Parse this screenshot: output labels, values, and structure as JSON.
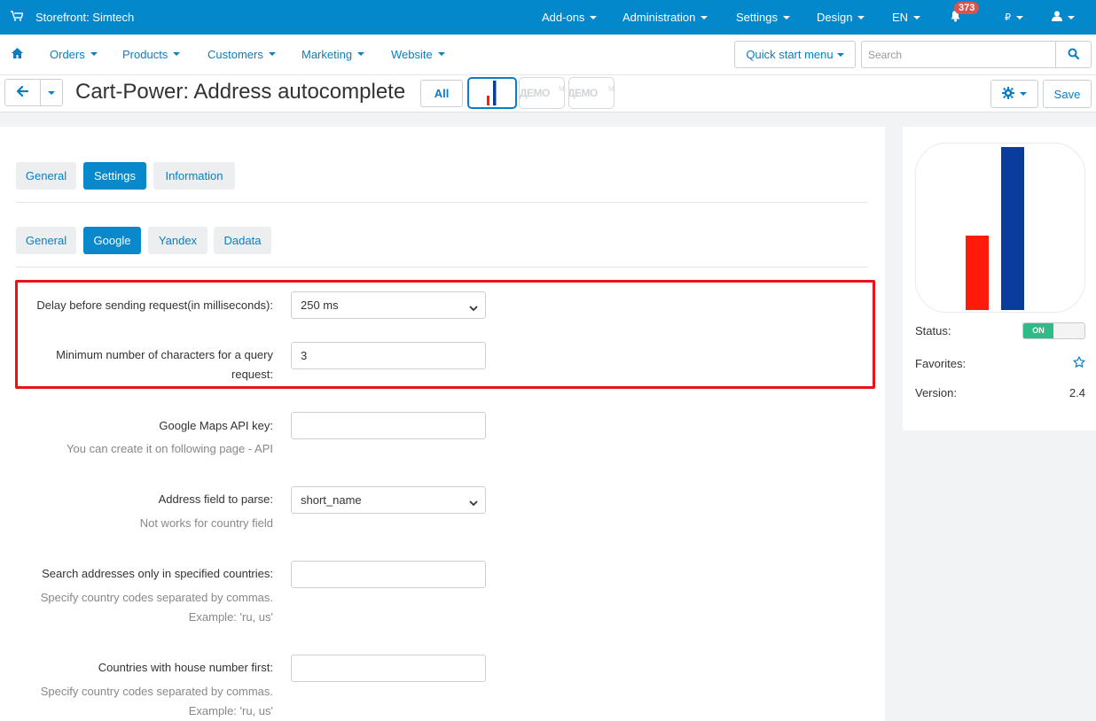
{
  "topbar": {
    "store": "Storefront: Simtech",
    "menus": [
      "Add-ons",
      "Administration",
      "Settings",
      "Design",
      "EN"
    ],
    "notifications": "373",
    "currency": "₽"
  },
  "nav": {
    "items": [
      "Orders",
      "Products",
      "Customers",
      "Marketing",
      "Website"
    ],
    "quick_start": "Quick start menu",
    "search_placeholder": "Search"
  },
  "titlebar": {
    "title": "Cart-Power: Address autocomplete",
    "all": "All",
    "demo": "ДЕМО",
    "demo_suffix": "МА",
    "save": "Save"
  },
  "tabs": {
    "main": [
      "General",
      "Settings",
      "Information"
    ],
    "sub": [
      "General",
      "Google",
      "Yandex",
      "Dadata"
    ]
  },
  "form": {
    "delay_label": "Delay before sending request(in milliseconds):",
    "delay_value": "250 ms",
    "minchars_label_1": "Minimum number of characters for a query",
    "minchars_label_2": "request:",
    "minchars_value": "3",
    "apikey_label": "Google Maps API key:",
    "apikey_hint": "You can create it on following page - API",
    "parse_label": "Address field to parse:",
    "parse_value": "short_name",
    "parse_hint": "Not works for country field",
    "countries_label": "Search addresses only in specified countries:",
    "countries_hint_1": "Specify country codes separated by commas.",
    "countries_hint_2": "Example: 'ru, us'",
    "house_label": "Countries with house number first:",
    "house_hint_1": "Specify country codes separated by commas.",
    "house_hint_2": "Example: 'ru, us'"
  },
  "sidebar": {
    "status_label": "Status:",
    "status_value": "ON",
    "favorites_label": "Favorites:",
    "version_label": "Version:",
    "version_value": "2.4"
  },
  "colors": {
    "primary": "#0388cc",
    "link": "#0a7ec2",
    "highlight": "#e8121a",
    "logo_red": "#ff1a0a",
    "logo_blue": "#0a3c9e",
    "toggle_on": "#2fbb88"
  },
  "icons": [
    "cart-icon",
    "bell-icon",
    "user-icon",
    "home-icon",
    "search-icon",
    "arrow-left-icon",
    "gear-icon",
    "star-icon",
    "chevron-down-icon"
  ]
}
